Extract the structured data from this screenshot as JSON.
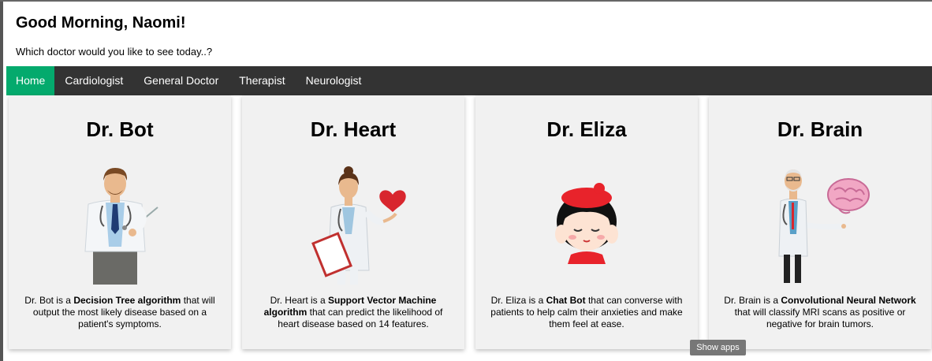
{
  "header": {
    "greeting": "Good Morning, Naomi!",
    "subtitle": "Which doctor would you like to see today..?"
  },
  "nav": {
    "items": [
      "Home",
      "Cardiologist",
      "General Doctor",
      "Therapist",
      "Neurologist"
    ],
    "active": "Home",
    "active_color": "#04AA6D",
    "bar_color": "#333333"
  },
  "cards": [
    {
      "title": "Dr. Bot",
      "desc_before": "Dr. Bot is a ",
      "desc_bold": "Decision Tree algorithm",
      "desc_after": " that will output the most likely disease based on a patient's symptoms.",
      "image": "male-doctor-pointer-illustration"
    },
    {
      "title": "Dr. Heart",
      "desc_before": "Dr. Heart is a ",
      "desc_bold": "Support Vector Machine algorithm",
      "desc_after": " that can predict the likelihood of heart disease based on 14 features.",
      "image": "female-doctor-heart-illustration"
    },
    {
      "title": "Dr. Eliza",
      "desc_before": "Dr. Eliza is a ",
      "desc_bold": "Chat Bot",
      "desc_after": " that can converse with patients to help calm their anxieties and make them feel at ease.",
      "image": "girl-red-beret-illustration"
    },
    {
      "title": "Dr. Brain",
      "desc_before": "Dr. Brain is a ",
      "desc_bold": "Convolutional Neural Network",
      "desc_after": " that will classify MRI scans as positive or negative for brain tumors.",
      "image": "old-doctor-brain-illustration"
    }
  ],
  "tooltip": {
    "show_apps": "Show apps"
  }
}
